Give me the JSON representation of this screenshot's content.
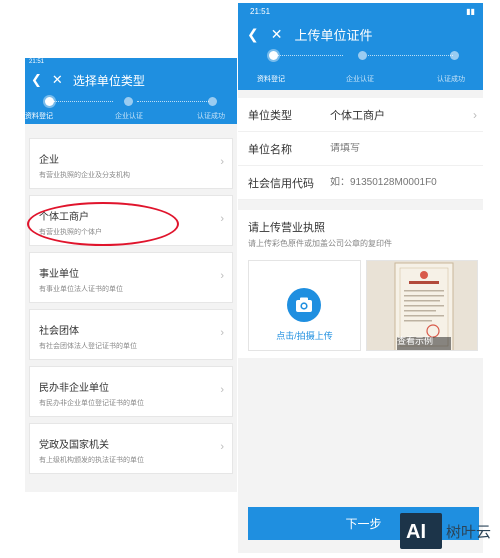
{
  "left": {
    "status_time": "21:51",
    "nav_title": "选择单位类型",
    "steps": [
      "资料登记",
      "企业认证",
      "认证成功"
    ],
    "types": [
      {
        "name": "企业",
        "desc": "有营业执照的企业及分支机构"
      },
      {
        "name": "个体工商户",
        "desc": "有营业执照的个体户"
      },
      {
        "name": "事业单位",
        "desc": "有事业单位法人证书的单位"
      },
      {
        "name": "社会团体",
        "desc": "有社会团体法人登记证书的单位"
      },
      {
        "name": "民办非企业单位",
        "desc": "有民办非企业单位登记证书的单位"
      },
      {
        "name": "党政及国家机关",
        "desc": "有上级机构颁发的执法证书的单位"
      }
    ]
  },
  "right": {
    "status_time": "21:51",
    "nav_title": "上传单位证件",
    "steps": [
      "资料登记",
      "企业认证",
      "认证成功"
    ],
    "form": {
      "unit_type_label": "单位类型",
      "unit_type_value": "个体工商户",
      "unit_name_label": "单位名称",
      "unit_name_placeholder": "请填写",
      "credit_code_label": "社会信用代码",
      "credit_code_placeholder": "如：91350128M0001F0"
    },
    "upload": {
      "heading": "请上传营业执照",
      "hint": "请上传彩色原件或加盖公司公章的复印件",
      "upload_caption": "点击/拍摄上传",
      "sample_caption": "查看示例"
    },
    "next_label": "下一步"
  },
  "colors": {
    "primary": "#1f8fe0",
    "highlight": "#e0142c"
  },
  "watermark": {
    "logo_text": "AI",
    "name": "树叶云"
  }
}
